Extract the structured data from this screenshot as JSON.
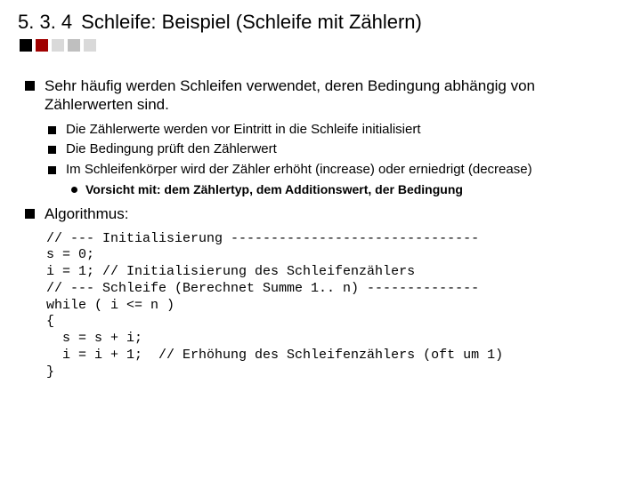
{
  "heading": {
    "section_number": "5. 3. 4",
    "title": "Schleife: Beispiel (Schleife mit Zählern)"
  },
  "bullets": {
    "b1": "Sehr häufig werden Schleifen verwendet, deren Bedingung abhängig von Zählerwerten sind.",
    "b1_sub1": "Die Zählerwerte werden vor Eintritt in die Schleife initialisiert",
    "b1_sub2": "Die Bedingung prüft den Zählerwert",
    "b1_sub3": "Im Schleifenkörper wird der Zähler erhöht (increase) oder erniedrigt (decrease)",
    "b1_sub3_sub1": "Vorsicht mit: dem Zählertyp, dem Additionswert, der Bedingung",
    "b2": "Algorithmus:"
  },
  "code": "// --- Initialisierung -------------------------------\ns = 0;\ni = 1; // Initialisierung des Schleifenzählers\n// --- Schleife (Berechnet Summe 1.. n) --------------\nwhile ( i <= n )\n{\n  s = s + i;\n  i = i + 1;  // Erhöhung des Schleifenzählers (oft um 1)\n}"
}
